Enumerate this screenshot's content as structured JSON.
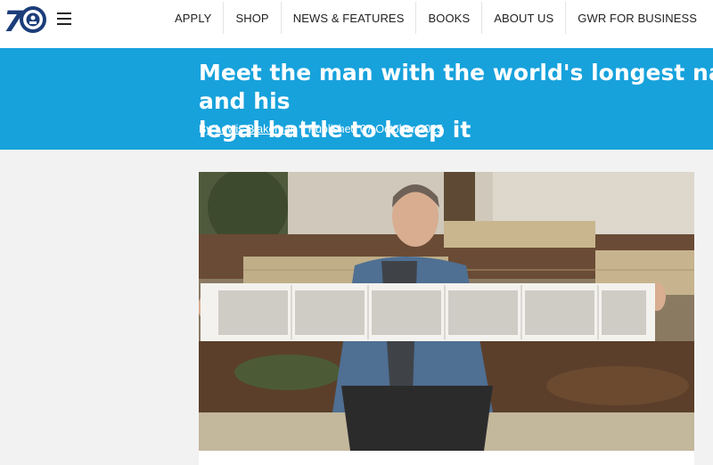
{
  "header": {
    "logo_icon": "gwr-70-logo-icon",
    "menu_icon": "hamburger-menu-icon",
    "nav": [
      {
        "label": "APPLY"
      },
      {
        "label": "SHOP"
      },
      {
        "label": "NEWS & FEATURES"
      },
      {
        "label": "BOOKS"
      },
      {
        "label": "ABOUT US"
      },
      {
        "label": "GWR FOR BUSINESS"
      }
    ]
  },
  "article": {
    "title": "Meet the man with the world's longest name and his\nlegal battle to keep it",
    "by_prefix": "By",
    "author": "Lewis Blakeman",
    "published": "Published 07 October 2025"
  },
  "colors": {
    "hero_blue": "#17a2dc",
    "logo_navy": "#1b3d7a"
  }
}
